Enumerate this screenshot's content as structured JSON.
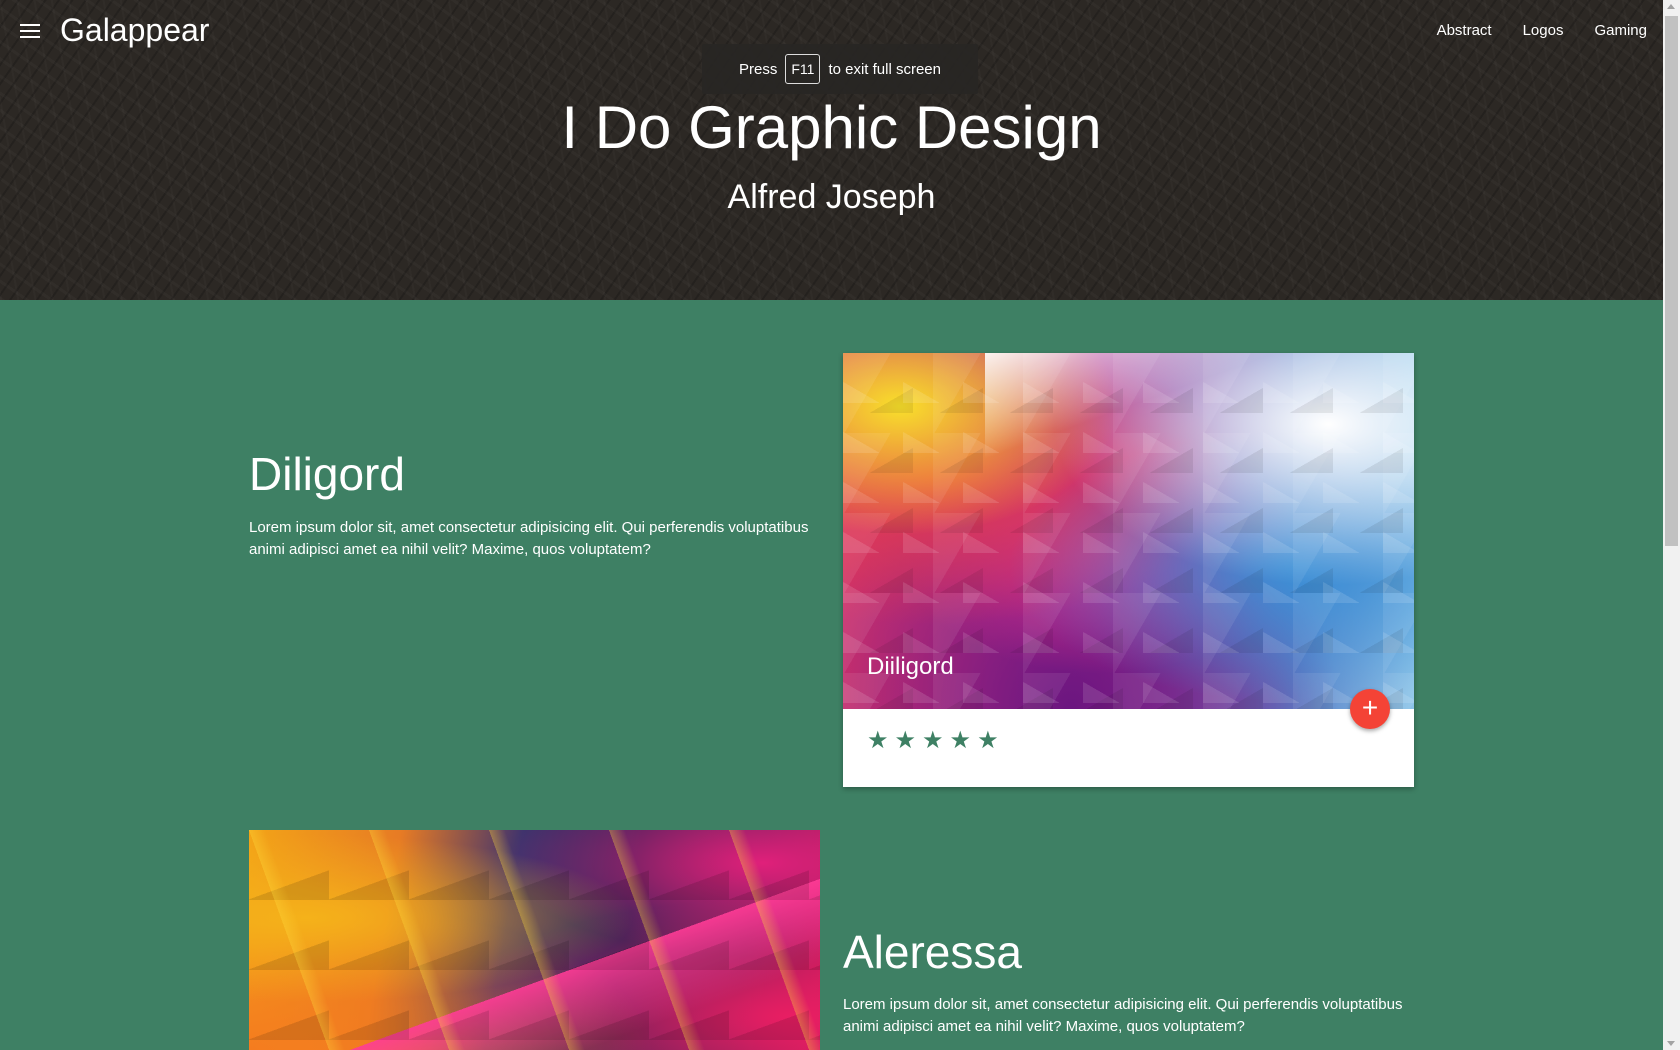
{
  "app": {
    "brand": "Galappear",
    "nav": [
      "Abstract",
      "Logos",
      "Gaming"
    ]
  },
  "fullscreen_notice": {
    "before": "Press",
    "key": "F11",
    "after": "to exit full screen"
  },
  "hero": {
    "title": "I Do Graphic Design",
    "subtitle": "Alfred Joseph"
  },
  "sections": [
    {
      "title": "Diligord",
      "text": "Lorem ipsum dolor sit, amet consectetur adipisicing elit. Qui perferendis voluptatibus animi adipisci amet ea nihil velit? Maxime, quos voluptatem?",
      "card": {
        "caption": "Diiligord",
        "fab_label": "+",
        "rating": 5,
        "stars": [
          "★",
          "★",
          "★",
          "★",
          "★"
        ]
      }
    },
    {
      "title": "Aleressa",
      "text": "Lorem ipsum dolor sit, amet consectetur adipisicing elit. Qui perferendis voluptatibus animi adipisci amet ea nihil velit? Maxime, quos voluptatem?"
    }
  ],
  "colors": {
    "hero_bg": "#2c2824",
    "section_bg": "#3e8064",
    "fab": "#f44336",
    "star": "#3e8064"
  },
  "icons": {
    "menu": "hamburger-menu-icon",
    "star": "star-icon",
    "add": "plus-icon"
  }
}
